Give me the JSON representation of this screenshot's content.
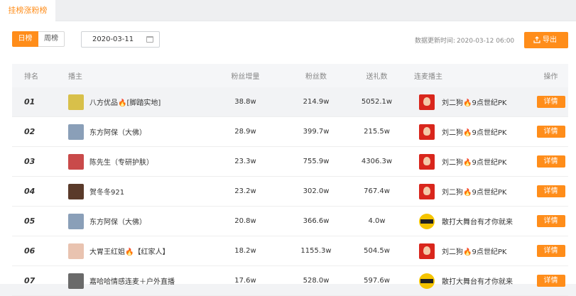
{
  "tabs": {
    "active": "挂榜涨粉榜"
  },
  "controls": {
    "day_label": "日榜",
    "week_label": "周榜",
    "date_value": "2020-03-11",
    "update_label": "数据更新时间:",
    "update_time": "2020-03-12 06:00",
    "export_label": "导出"
  },
  "table": {
    "headers": {
      "rank": "排名",
      "anchor": "播主",
      "fan_gain": "粉丝增量",
      "fans": "粉丝数",
      "gifts": "送礼数",
      "peer": "连麦播主",
      "op": "操作"
    },
    "detail_label": "详情",
    "rows": [
      {
        "rank": "01",
        "name": "八方优品🔥[脚踏实地]",
        "fan_gain": "38.8w",
        "fans": "214.9w",
        "gifts": "5052.1w",
        "peer": "刘二狗🔥9点世纪PK",
        "avatar_color": "#d8c04a",
        "peer_style": "red"
      },
      {
        "rank": "02",
        "name": "东方阿保（大佛）",
        "fan_gain": "28.9w",
        "fans": "399.7w",
        "gifts": "215.5w",
        "peer": "刘二狗🔥9点世纪PK",
        "avatar_color": "#8a9fb8",
        "peer_style": "red"
      },
      {
        "rank": "03",
        "name": "陈先生（专研护肤）",
        "fan_gain": "23.3w",
        "fans": "755.9w",
        "gifts": "4306.3w",
        "peer": "刘二狗🔥9点世纪PK",
        "avatar_color": "#c94a4a",
        "peer_style": "red"
      },
      {
        "rank": "04",
        "name": "贺冬冬921",
        "fan_gain": "23.2w",
        "fans": "302.0w",
        "gifts": "767.4w",
        "peer": "刘二狗🔥9点世纪PK",
        "avatar_color": "#5a3a2a",
        "peer_style": "red"
      },
      {
        "rank": "05",
        "name": "东方阿保（大佛）",
        "fan_gain": "20.8w",
        "fans": "366.6w",
        "gifts": "4.0w",
        "peer": "散打大舞台有才你就来",
        "avatar_color": "#8a9fb8",
        "peer_style": "yellow"
      },
      {
        "rank": "06",
        "name": "大胃王红姐🔥【红家人】",
        "fan_gain": "18.2w",
        "fans": "1155.3w",
        "gifts": "504.5w",
        "peer": "刘二狗🔥9点世纪PK",
        "avatar_color": "#e9c3b0",
        "peer_style": "red"
      },
      {
        "rank": "07",
        "name": "嘉哈哈情感连麦＋户外直播",
        "fan_gain": "17.6w",
        "fans": "528.0w",
        "gifts": "597.6w",
        "peer": "散打大舞台有才你就来",
        "avatar_color": "#6a6a6a",
        "peer_style": "yellow"
      }
    ]
  }
}
